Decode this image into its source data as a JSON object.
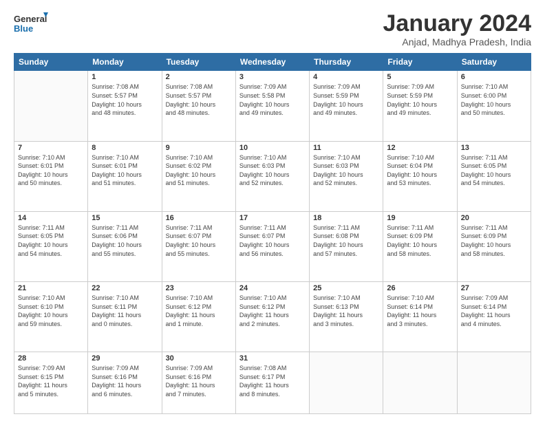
{
  "logo": {
    "line1": "General",
    "line2": "Blue"
  },
  "title": "January 2024",
  "location": "Anjad, Madhya Pradesh, India",
  "days_header": [
    "Sunday",
    "Monday",
    "Tuesday",
    "Wednesday",
    "Thursday",
    "Friday",
    "Saturday"
  ],
  "weeks": [
    [
      {
        "num": "",
        "detail": ""
      },
      {
        "num": "1",
        "detail": "Sunrise: 7:08 AM\nSunset: 5:57 PM\nDaylight: 10 hours\nand 48 minutes."
      },
      {
        "num": "2",
        "detail": "Sunrise: 7:08 AM\nSunset: 5:57 PM\nDaylight: 10 hours\nand 48 minutes."
      },
      {
        "num": "3",
        "detail": "Sunrise: 7:09 AM\nSunset: 5:58 PM\nDaylight: 10 hours\nand 49 minutes."
      },
      {
        "num": "4",
        "detail": "Sunrise: 7:09 AM\nSunset: 5:59 PM\nDaylight: 10 hours\nand 49 minutes."
      },
      {
        "num": "5",
        "detail": "Sunrise: 7:09 AM\nSunset: 5:59 PM\nDaylight: 10 hours\nand 49 minutes."
      },
      {
        "num": "6",
        "detail": "Sunrise: 7:10 AM\nSunset: 6:00 PM\nDaylight: 10 hours\nand 50 minutes."
      }
    ],
    [
      {
        "num": "7",
        "detail": "Sunrise: 7:10 AM\nSunset: 6:01 PM\nDaylight: 10 hours\nand 50 minutes."
      },
      {
        "num": "8",
        "detail": "Sunrise: 7:10 AM\nSunset: 6:01 PM\nDaylight: 10 hours\nand 51 minutes."
      },
      {
        "num": "9",
        "detail": "Sunrise: 7:10 AM\nSunset: 6:02 PM\nDaylight: 10 hours\nand 51 minutes."
      },
      {
        "num": "10",
        "detail": "Sunrise: 7:10 AM\nSunset: 6:03 PM\nDaylight: 10 hours\nand 52 minutes."
      },
      {
        "num": "11",
        "detail": "Sunrise: 7:10 AM\nSunset: 6:03 PM\nDaylight: 10 hours\nand 52 minutes."
      },
      {
        "num": "12",
        "detail": "Sunrise: 7:10 AM\nSunset: 6:04 PM\nDaylight: 10 hours\nand 53 minutes."
      },
      {
        "num": "13",
        "detail": "Sunrise: 7:11 AM\nSunset: 6:05 PM\nDaylight: 10 hours\nand 54 minutes."
      }
    ],
    [
      {
        "num": "14",
        "detail": "Sunrise: 7:11 AM\nSunset: 6:05 PM\nDaylight: 10 hours\nand 54 minutes."
      },
      {
        "num": "15",
        "detail": "Sunrise: 7:11 AM\nSunset: 6:06 PM\nDaylight: 10 hours\nand 55 minutes."
      },
      {
        "num": "16",
        "detail": "Sunrise: 7:11 AM\nSunset: 6:07 PM\nDaylight: 10 hours\nand 55 minutes."
      },
      {
        "num": "17",
        "detail": "Sunrise: 7:11 AM\nSunset: 6:07 PM\nDaylight: 10 hours\nand 56 minutes."
      },
      {
        "num": "18",
        "detail": "Sunrise: 7:11 AM\nSunset: 6:08 PM\nDaylight: 10 hours\nand 57 minutes."
      },
      {
        "num": "19",
        "detail": "Sunrise: 7:11 AM\nSunset: 6:09 PM\nDaylight: 10 hours\nand 58 minutes."
      },
      {
        "num": "20",
        "detail": "Sunrise: 7:11 AM\nSunset: 6:09 PM\nDaylight: 10 hours\nand 58 minutes."
      }
    ],
    [
      {
        "num": "21",
        "detail": "Sunrise: 7:10 AM\nSunset: 6:10 PM\nDaylight: 10 hours\nand 59 minutes."
      },
      {
        "num": "22",
        "detail": "Sunrise: 7:10 AM\nSunset: 6:11 PM\nDaylight: 11 hours\nand 0 minutes."
      },
      {
        "num": "23",
        "detail": "Sunrise: 7:10 AM\nSunset: 6:12 PM\nDaylight: 11 hours\nand 1 minute."
      },
      {
        "num": "24",
        "detail": "Sunrise: 7:10 AM\nSunset: 6:12 PM\nDaylight: 11 hours\nand 2 minutes."
      },
      {
        "num": "25",
        "detail": "Sunrise: 7:10 AM\nSunset: 6:13 PM\nDaylight: 11 hours\nand 3 minutes."
      },
      {
        "num": "26",
        "detail": "Sunrise: 7:10 AM\nSunset: 6:14 PM\nDaylight: 11 hours\nand 3 minutes."
      },
      {
        "num": "27",
        "detail": "Sunrise: 7:09 AM\nSunset: 6:14 PM\nDaylight: 11 hours\nand 4 minutes."
      }
    ],
    [
      {
        "num": "28",
        "detail": "Sunrise: 7:09 AM\nSunset: 6:15 PM\nDaylight: 11 hours\nand 5 minutes."
      },
      {
        "num": "29",
        "detail": "Sunrise: 7:09 AM\nSunset: 6:16 PM\nDaylight: 11 hours\nand 6 minutes."
      },
      {
        "num": "30",
        "detail": "Sunrise: 7:09 AM\nSunset: 6:16 PM\nDaylight: 11 hours\nand 7 minutes."
      },
      {
        "num": "31",
        "detail": "Sunrise: 7:08 AM\nSunset: 6:17 PM\nDaylight: 11 hours\nand 8 minutes."
      },
      {
        "num": "",
        "detail": ""
      },
      {
        "num": "",
        "detail": ""
      },
      {
        "num": "",
        "detail": ""
      }
    ]
  ]
}
